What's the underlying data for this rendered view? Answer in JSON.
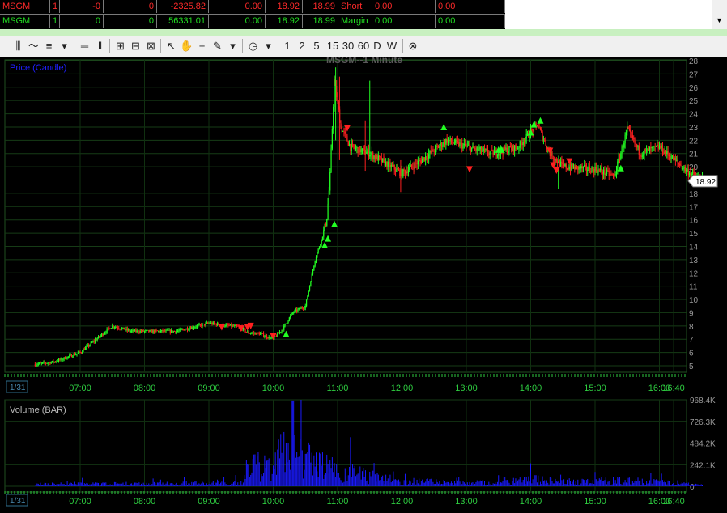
{
  "positions": [
    {
      "symbol": "MSGM",
      "qty": "1",
      "pos": "-0",
      "num": "0",
      "pnl": "-2325.82",
      "val": "0.00",
      "bid": "18.92",
      "ask": "18.99",
      "label": "Short",
      "a": "0.00",
      "b": "0.00",
      "color": "#ff2a2a"
    },
    {
      "symbol": "MSGM",
      "qty": "1",
      "pos": "0",
      "num": "0",
      "pnl": "56331.01",
      "val": "0.00",
      "bid": "18.92",
      "ask": "18.99",
      "label": "Margin",
      "a": "0.00",
      "b": "0.00",
      "color": "#22dd22"
    }
  ],
  "toolbar": {
    "icons": [
      "candle-chart-icon",
      "line-chart-icon",
      "bar-chart-icon",
      "dropdown-icon",
      "hline-icon",
      "vline-icon",
      "crosshair-box-icon",
      "grid-icon",
      "zoom-icon",
      "pointer-icon",
      "hand-icon",
      "cross-icon",
      "pen-icon",
      "dropdown-icon",
      "clock-icon",
      "dropdown-icon"
    ],
    "intervals": [
      "1",
      "2",
      "5",
      "15",
      "30",
      "60",
      "D",
      "W"
    ],
    "close": "⊗"
  },
  "chart_data": [
    {
      "type": "candlestick",
      "title": "MSGM--1 Minute",
      "panel_label": "Price (Candle)",
      "last_price": "18.92",
      "ylim": [
        4.5,
        28.2
      ],
      "y_ticks": [
        "5",
        "6",
        "7",
        "8",
        "9",
        "10",
        "11",
        "12",
        "13",
        "14",
        "15",
        "16",
        "17",
        "18",
        "19",
        "20",
        "21",
        "22",
        "23",
        "24",
        "25",
        "26",
        "27",
        "28"
      ],
      "x_ticks": [
        "07:00",
        "08:00",
        "09:00",
        "10:00",
        "11:00",
        "12:00",
        "13:00",
        "14:00",
        "15:00",
        "16:00",
        "16:40"
      ],
      "date_label": "1/31",
      "path_x": [
        6.3,
        6.6,
        7.0,
        7.5,
        7.8,
        8.5,
        9.0,
        9.5,
        9.6,
        9.8,
        10.0,
        10.15,
        10.3,
        10.5,
        10.65,
        10.75,
        10.83,
        10.88,
        10.95,
        11.05,
        11.2,
        11.5,
        12.0,
        12.3,
        12.7,
        13.0,
        13.4,
        13.8,
        14.1,
        14.3,
        14.5,
        15.0,
        15.3,
        15.5,
        15.7,
        16.0,
        16.4,
        16.67
      ],
      "path_y": [
        5.1,
        5.3,
        6.0,
        8.0,
        7.6,
        7.6,
        8.2,
        7.9,
        7.5,
        7.4,
        7.0,
        7.8,
        9.0,
        9.5,
        13.0,
        14.5,
        16.0,
        19.0,
        26.5,
        23.0,
        21.5,
        21.0,
        19.5,
        20.5,
        22.0,
        21.5,
        21.0,
        21.5,
        23.2,
        21.0,
        20.0,
        19.8,
        19.3,
        22.8,
        21.0,
        21.5,
        19.8,
        18.92
      ],
      "buy_markers": [
        [
          10.2,
          7.4
        ],
        [
          10.8,
          14.1
        ],
        [
          10.85,
          14.6
        ],
        [
          10.95,
          15.7
        ],
        [
          12.65,
          23.0
        ],
        [
          13.5,
          21.3
        ],
        [
          13.55,
          21.3
        ],
        [
          14.0,
          22.6
        ],
        [
          14.05,
          23.2
        ],
        [
          14.15,
          23.5
        ],
        [
          15.4,
          19.9
        ]
      ],
      "sell_markers": [
        [
          9.2,
          7.9
        ],
        [
          9.5,
          7.8
        ],
        [
          9.6,
          7.9
        ],
        [
          9.65,
          8.0
        ],
        [
          10.0,
          7.2
        ],
        [
          11.15,
          22.9
        ],
        [
          13.05,
          19.8
        ],
        [
          14.3,
          21.2
        ],
        [
          14.35,
          20.1
        ],
        [
          14.4,
          19.7
        ],
        [
          14.6,
          20.4
        ]
      ]
    },
    {
      "type": "bar",
      "title": "Volume (BAR)",
      "ylim": [
        0,
        968000
      ],
      "y_ticks": [
        "968.4K",
        "726.3K",
        "484.2K",
        "242.1K",
        "0"
      ],
      "x_ticks": [
        "07:00",
        "08:00",
        "09:00",
        "10:00",
        "11:00",
        "12:00",
        "13:00",
        "14:00",
        "15:00",
        "16:00",
        "16:40"
      ],
      "date_label": "1/31",
      "profile_x": [
        6.0,
        9.5,
        9.6,
        10.0,
        10.2,
        10.3,
        10.5,
        10.8,
        11.0,
        11.5,
        12.0,
        13.5,
        14.0,
        14.5,
        15.5,
        16.0,
        16.67
      ],
      "profile_v": [
        30000,
        50000,
        300000,
        320000,
        650000,
        500000,
        420000,
        300000,
        250000,
        150000,
        80000,
        50000,
        110000,
        70000,
        90000,
        60000,
        20000
      ]
    }
  ]
}
